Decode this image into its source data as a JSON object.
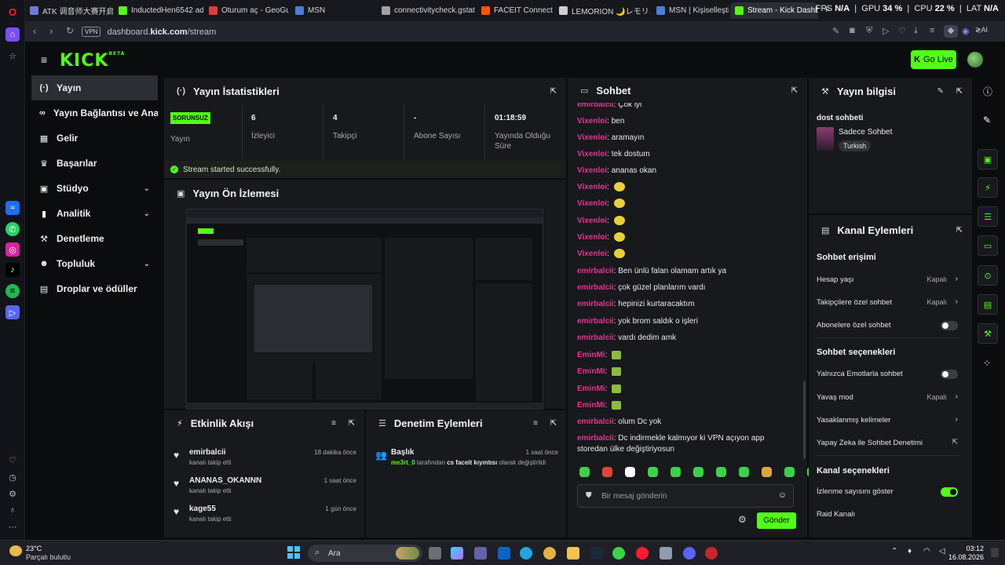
{
  "browser": {
    "tabs": [
      {
        "label": "ATK 调音师大赛开启 ✨ ·",
        "color": "#6b7bd6"
      },
      {
        "label": "InductedHen6542 adlı kişi",
        "color": "#53fc18"
      },
      {
        "label": "Oturum aç - GeoGuessr",
        "color": "#e23b3b"
      },
      {
        "label": "MSN",
        "color": "#4a7fd9"
      },
      {
        "label": "connectivitycheck.gstatic.c",
        "color": "#9aa0a6"
      },
      {
        "label": "FACEIT Connect",
        "color": "#ff5500"
      },
      {
        "label": "LEMORION 🌙レモリオン (@",
        "color": "#cfcfcf"
      },
      {
        "label": "MSN | Kişiselleştirilmiş Ha",
        "color": "#4a7fd9"
      },
      {
        "label": "Stream - Kick Dashboard",
        "color": "#53fc18"
      }
    ],
    "stats": {
      "fps_label": "FPS",
      "fps": "N/A",
      "gpu_label": "GPU",
      "gpu": "34 %",
      "cpu_label": "CPU",
      "cpu": "22 %",
      "lat_label": "LAT",
      "lat": "N/A"
    },
    "vpn": "VPN",
    "url_prefix": "dashboard.",
    "url_host": "kick.com",
    "url_path": "/stream",
    "ai_label": "AI"
  },
  "kick": {
    "logo": "KICK",
    "logo_beta": "BETA",
    "go_live": "Go Live",
    "nav": [
      {
        "label": "Yayın",
        "icon": "(·)",
        "chev": ""
      },
      {
        "label": "Yayın Bağlantısı ve Anahtarı",
        "icon": "∞",
        "chev": ""
      },
      {
        "label": "Gelir",
        "icon": "▦",
        "chev": ""
      },
      {
        "label": "Başarılar",
        "icon": "♛",
        "chev": ""
      },
      {
        "label": "Stüdyo",
        "icon": "▣",
        "chev": "⌄"
      },
      {
        "label": "Analitik",
        "icon": "▮",
        "chev": "⌄"
      },
      {
        "label": "Denetleme",
        "icon": "⚒",
        "chev": ""
      },
      {
        "label": "Topluluk",
        "icon": "☻",
        "chev": "⌄"
      },
      {
        "label": "Droplar ve ödüller",
        "icon": "▤",
        "chev": ""
      }
    ],
    "stats_panel": {
      "title": "Yayın İstatistikleri",
      "badge": "SORUNSUZ",
      "cells": [
        {
          "value": "",
          "label": "Yayın"
        },
        {
          "value": "6",
          "label": "İzleyici"
        },
        {
          "value": "4",
          "label": "Takipçi"
        },
        {
          "value": "-",
          "label": "Abone Sayısı"
        },
        {
          "value": "01:18:59",
          "label": "Yayında Olduğu Süre"
        }
      ],
      "success": "Stream started successfully."
    },
    "preview_panel": {
      "title": "Yayın Ön İzlemesi"
    },
    "activity_panel": {
      "title": "Etkinlik Akışı",
      "items": [
        {
          "name": "emirbalcii",
          "sub": "kanalı takip etti",
          "time": "18 dakika önce"
        },
        {
          "name": "ANANAS_OKANNN",
          "sub": "kanalı takip etti",
          "time": "1 saat önce"
        },
        {
          "name": "kage55",
          "sub": "kanalı takip etti",
          "time": "1 gün önce"
        }
      ]
    },
    "mod_panel": {
      "title": "Denetim Eylemleri",
      "item": {
        "title": "Başlık",
        "time": "1 saat önce",
        "user": "me3rt_0",
        "mid": " tarafından ",
        "value": "cs faceit kıyıntısı",
        "end": " olarak değiştirildi"
      }
    },
    "chat_panel": {
      "title": "Sohbet",
      "messages": [
        {
          "user": "emirbalcii",
          "text": "Çok iyi",
          "color": "#e5358f",
          "emote": ""
        },
        {
          "user": "Vixenloi",
          "text": "ben",
          "color": "#e5358f",
          "emote": ""
        },
        {
          "user": "Vixenloi",
          "text": "aramayın",
          "color": "#e5358f",
          "emote": ""
        },
        {
          "user": "Vixenloi",
          "text": "tek dostum",
          "color": "#e5358f",
          "emote": ""
        },
        {
          "user": "Vixenloi",
          "text": "ananas okan",
          "color": "#e5358f",
          "emote": ""
        },
        {
          "user": "Vixenloi",
          "text": "",
          "color": "#e5358f",
          "emote": "round"
        },
        {
          "user": "Vixenloi",
          "text": "",
          "color": "#e5358f",
          "emote": "round"
        },
        {
          "user": "Vixenloi",
          "text": "",
          "color": "#e5358f",
          "emote": "round"
        },
        {
          "user": "Vixenloi",
          "text": "",
          "color": "#e5358f",
          "emote": "round"
        },
        {
          "user": "Vixenloi",
          "text": "",
          "color": "#e5358f",
          "emote": "round"
        },
        {
          "user": "emirbalcii",
          "text": "Ben ünlü falan olamam artık ya",
          "color": "#e5358f",
          "emote": ""
        },
        {
          "user": "emirbalcii",
          "text": "çok güzel planlarım vardı",
          "color": "#e5358f",
          "emote": ""
        },
        {
          "user": "emirbalcii",
          "text": "hepinizi kurtaracaktım",
          "color": "#e5358f",
          "emote": ""
        },
        {
          "user": "emirbalcii",
          "text": "yok brom saldık o işleri",
          "color": "#e5358f",
          "emote": ""
        },
        {
          "user": "emirbalcii",
          "text": "vardı dedim amk",
          "color": "#e5358f",
          "emote": ""
        },
        {
          "user": "EminMi",
          "text": "",
          "color": "#e5358f",
          "emote": "square"
        },
        {
          "user": "EminMi",
          "text": "",
          "color": "#e5358f",
          "emote": "square"
        },
        {
          "user": "EminMi",
          "text": "",
          "color": "#e5358f",
          "emote": "square"
        },
        {
          "user": "EminMi",
          "text": "",
          "color": "#e5358f",
          "emote": "square"
        },
        {
          "user": "emirbalcii",
          "text": "olum Dc yok",
          "color": "#e5358f",
          "emote": ""
        },
        {
          "user": "emirbalcii",
          "text": "Dc indirmekle kalmıyor ki VPN açıyon app storedan ülke değiştiriyosun",
          "color": "#e5358f",
          "emote": ""
        }
      ],
      "input_placeholder": "Bir mesaj gönderin",
      "send": "Gönder"
    },
    "info_panel": {
      "title": "Yayın bilgisi",
      "stream_title": "dost sohbeti",
      "category": "Sadece Sohbet",
      "tag": "Turkish"
    },
    "channel_panel": {
      "title": "Kanal Eylemleri",
      "sec1": "Sohbet erişimi",
      "sec2": "Sohbet seçenekleri",
      "sec3": "Kanal seçenekleri",
      "rows1": [
        {
          "label": "Hesap yaşı",
          "value": "Kapalı"
        },
        {
          "label": "Takipçilere özel sohbet",
          "value": "Kapalı"
        },
        {
          "label": "Abonelere özel sohbet",
          "value": ""
        }
      ],
      "rows2": [
        {
          "label": "Yalnızca Emotlarla sohbet",
          "value": ""
        },
        {
          "label": "Yavaş mod",
          "value": "Kapalı"
        },
        {
          "label": "Yasaklanmış kelimeler",
          "value": ""
        },
        {
          "label": "Yapay Zeka ile Sohbet Denetimi",
          "value": ""
        }
      ],
      "rows3": [
        {
          "label": "İzlenme sayısını göster",
          "value": ""
        },
        {
          "label": "Raid Kanalı",
          "value": ""
        }
      ]
    }
  },
  "taskbar": {
    "weather_temp": "23°C",
    "weather_desc": "Parçalı bulutlu",
    "search": "Ara",
    "time": "03:12",
    "date": "16.08.2026"
  },
  "colors": {
    "accent": "#53fc18",
    "username": "#e5358f"
  }
}
